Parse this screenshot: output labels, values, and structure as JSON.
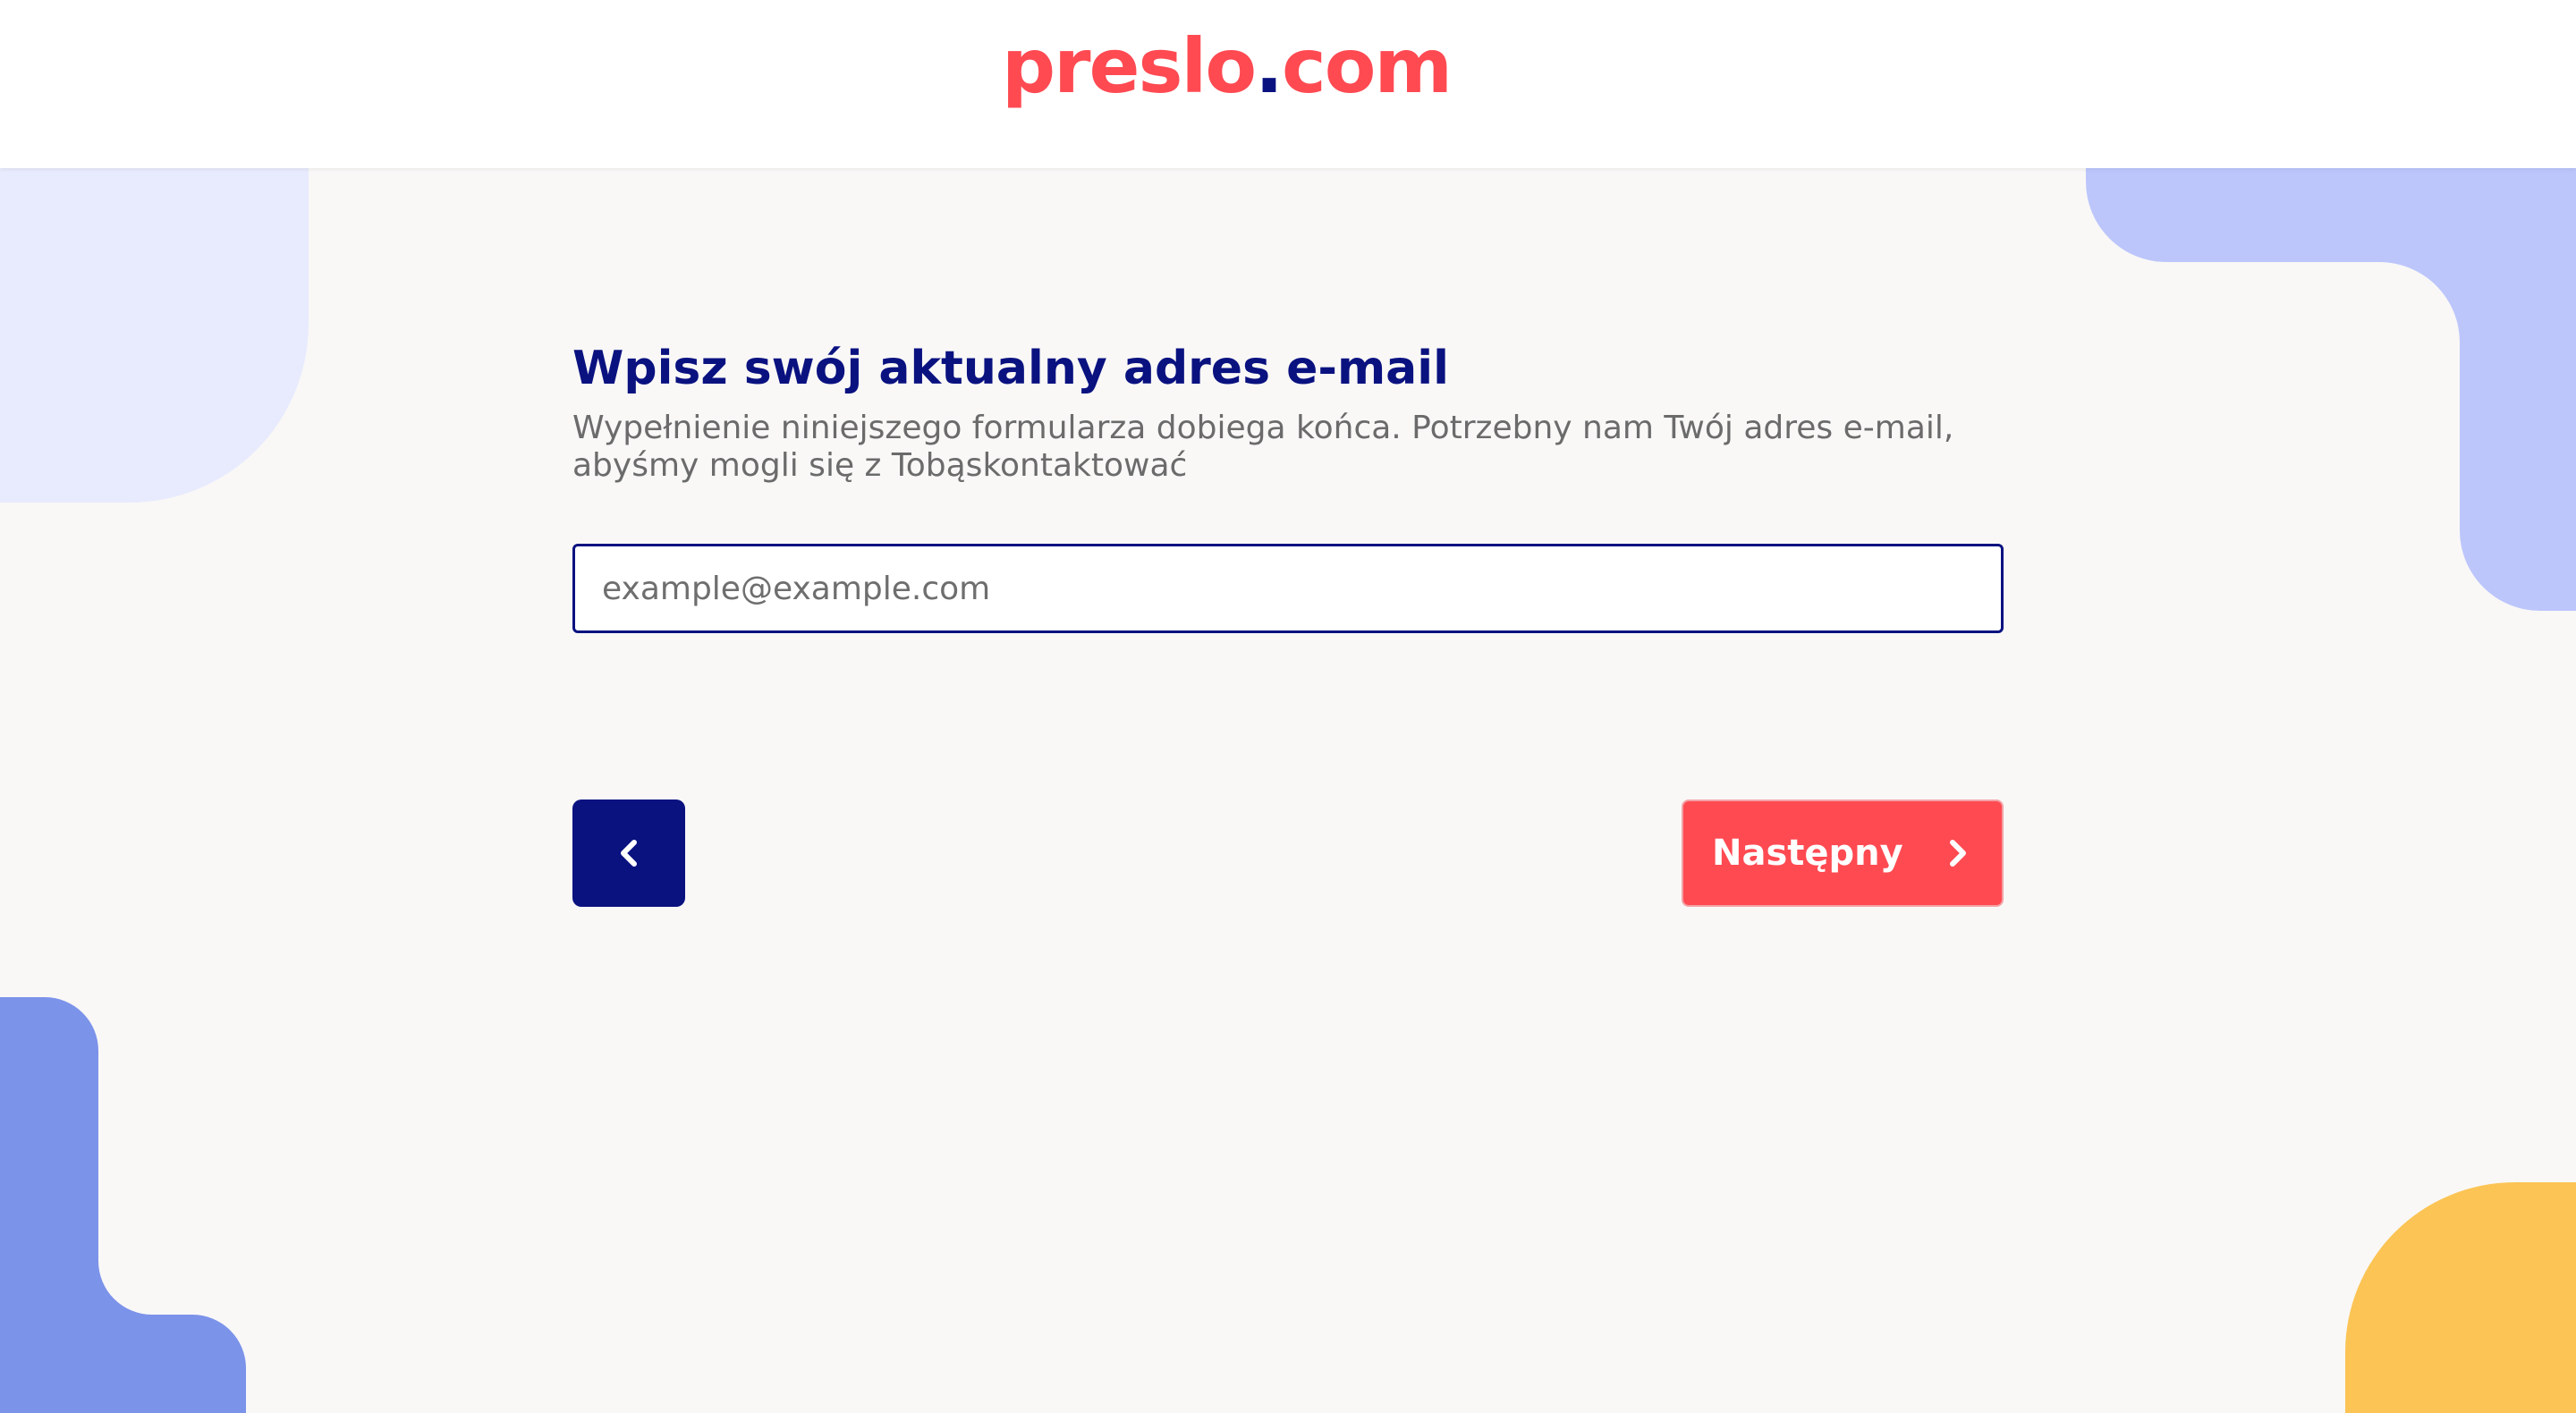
{
  "header": {
    "logo_brand": "preslo",
    "logo_dot": ".",
    "logo_tld": "com"
  },
  "form": {
    "title": "Wpisz swój aktualny adres e-mail",
    "subtitle": "Wypełnienie niniejszego formularza dobiega końca. Potrzebny nam Twój adres e-mail, abyśmy mogli się z Tobąskontaktować",
    "email_placeholder": "example@example.com",
    "email_value": ""
  },
  "navigation": {
    "back_icon": "chevron-left-icon",
    "next_label": "Następny",
    "next_icon": "chevron-right-icon"
  },
  "colors": {
    "brand_red": "#ff4a52",
    "brand_navy": "#0a1280",
    "background": "#f9f8f7",
    "shape_light_blue": "#e8ebfd",
    "shape_periwinkle": "#bcc6fb",
    "shape_blue": "#7c93ea",
    "shape_yellow": "#fcc454"
  }
}
